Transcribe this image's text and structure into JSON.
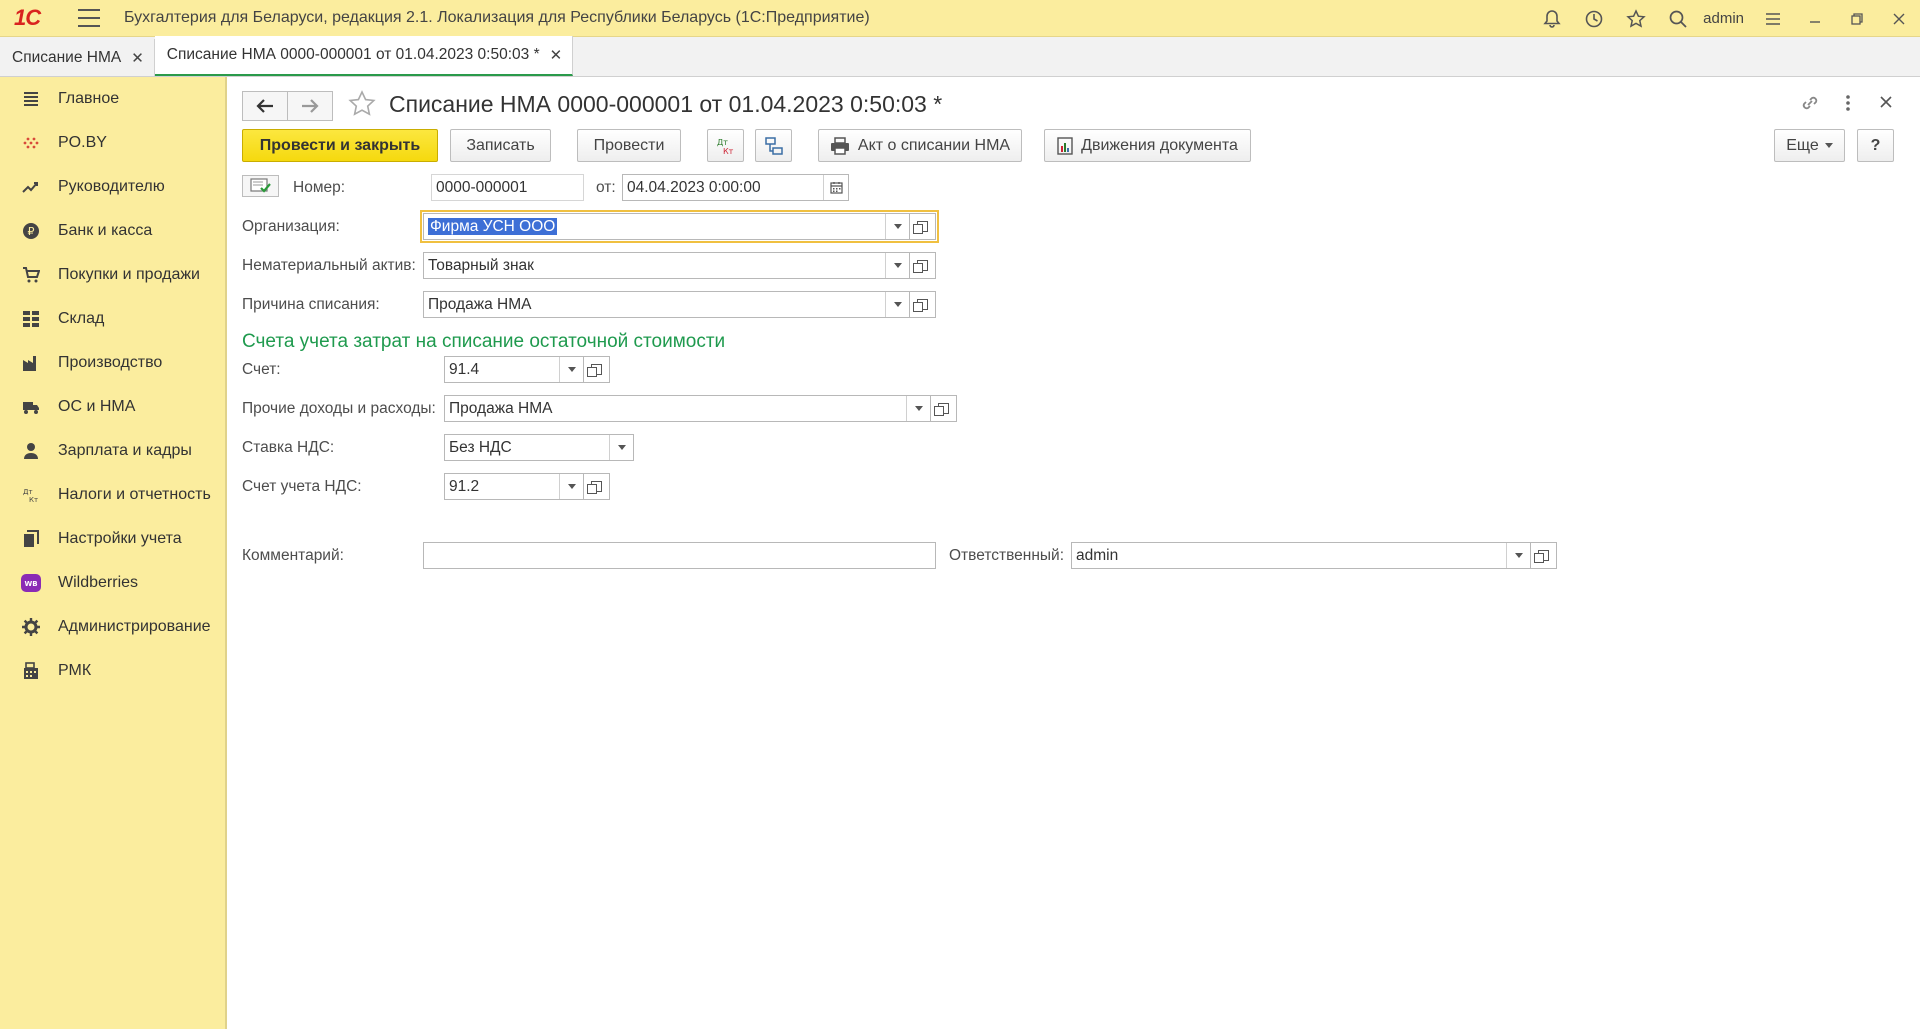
{
  "app": {
    "logo_text": "1С",
    "title": "Бухгалтерия для Беларуси, редакция 2.1. Локализация для Республики Беларусь   (1С:Предприятие)",
    "user": "admin"
  },
  "tabs": [
    {
      "label": "Списание НМА"
    },
    {
      "label": "Списание НМА 0000-000001 от 01.04.2023 0:50:03 *"
    }
  ],
  "sidebar": {
    "items": [
      {
        "label": "Главное",
        "icon": "menu-lines-icon"
      },
      {
        "label": "PO.BY",
        "icon": "dots-icon"
      },
      {
        "label": "Руководителю",
        "icon": "trend-icon"
      },
      {
        "label": "Банк и касса",
        "icon": "coin-icon"
      },
      {
        "label": "Покупки и продажи",
        "icon": "cart-icon"
      },
      {
        "label": "Склад",
        "icon": "warehouse-icon"
      },
      {
        "label": "Производство",
        "icon": "factory-icon"
      },
      {
        "label": "ОС и НМА",
        "icon": "truck-icon"
      },
      {
        "label": "Зарплата и кадры",
        "icon": "person-icon"
      },
      {
        "label": "Налоги и отчетность",
        "icon": "dt-kt-icon"
      },
      {
        "label": "Настройки учета",
        "icon": "books-icon"
      },
      {
        "label": "Wildberries",
        "icon": "wb-icon"
      },
      {
        "label": "Администрирование",
        "icon": "gear-icon"
      },
      {
        "label": "РМК",
        "icon": "register-icon"
      }
    ]
  },
  "document": {
    "title": "Списание НМА 0000-000001 от 01.04.2023 0:50:03 *",
    "toolbar": {
      "post_close": "Провести и закрыть",
      "save": "Записать",
      "post": "Провести",
      "dtkt": "Дт\nКт",
      "act": "Акт о списании НМА",
      "movements": "Движения документа",
      "more": "Еще",
      "help": "?"
    },
    "number_label": "Номер:",
    "number_value": "0000-000001",
    "date_label": "от:",
    "date_value": "04.04.2023  0:00:00",
    "org_label": "Организация:",
    "org_value": "Фирма УСН ООО",
    "asset_label": "Нематериальный актив:",
    "asset_value": "Товарный знак",
    "reason_label": "Причина списания:",
    "reason_value": "Продажа НМА",
    "section_title": "Счета учета затрат на списание остаточной стоимости",
    "account_label": "Счет:",
    "account_value": "91.4",
    "other_label": "Прочие доходы и расходы:",
    "other_value": "Продажа НМА",
    "vat_rate_label": "Ставка НДС:",
    "vat_rate_value": "Без НДС",
    "vat_account_label": "Счет учета НДС:",
    "vat_account_value": "91.2",
    "comment_label": "Комментарий:",
    "comment_value": "",
    "responsible_label": "Ответственный:",
    "responsible_value": "admin"
  }
}
